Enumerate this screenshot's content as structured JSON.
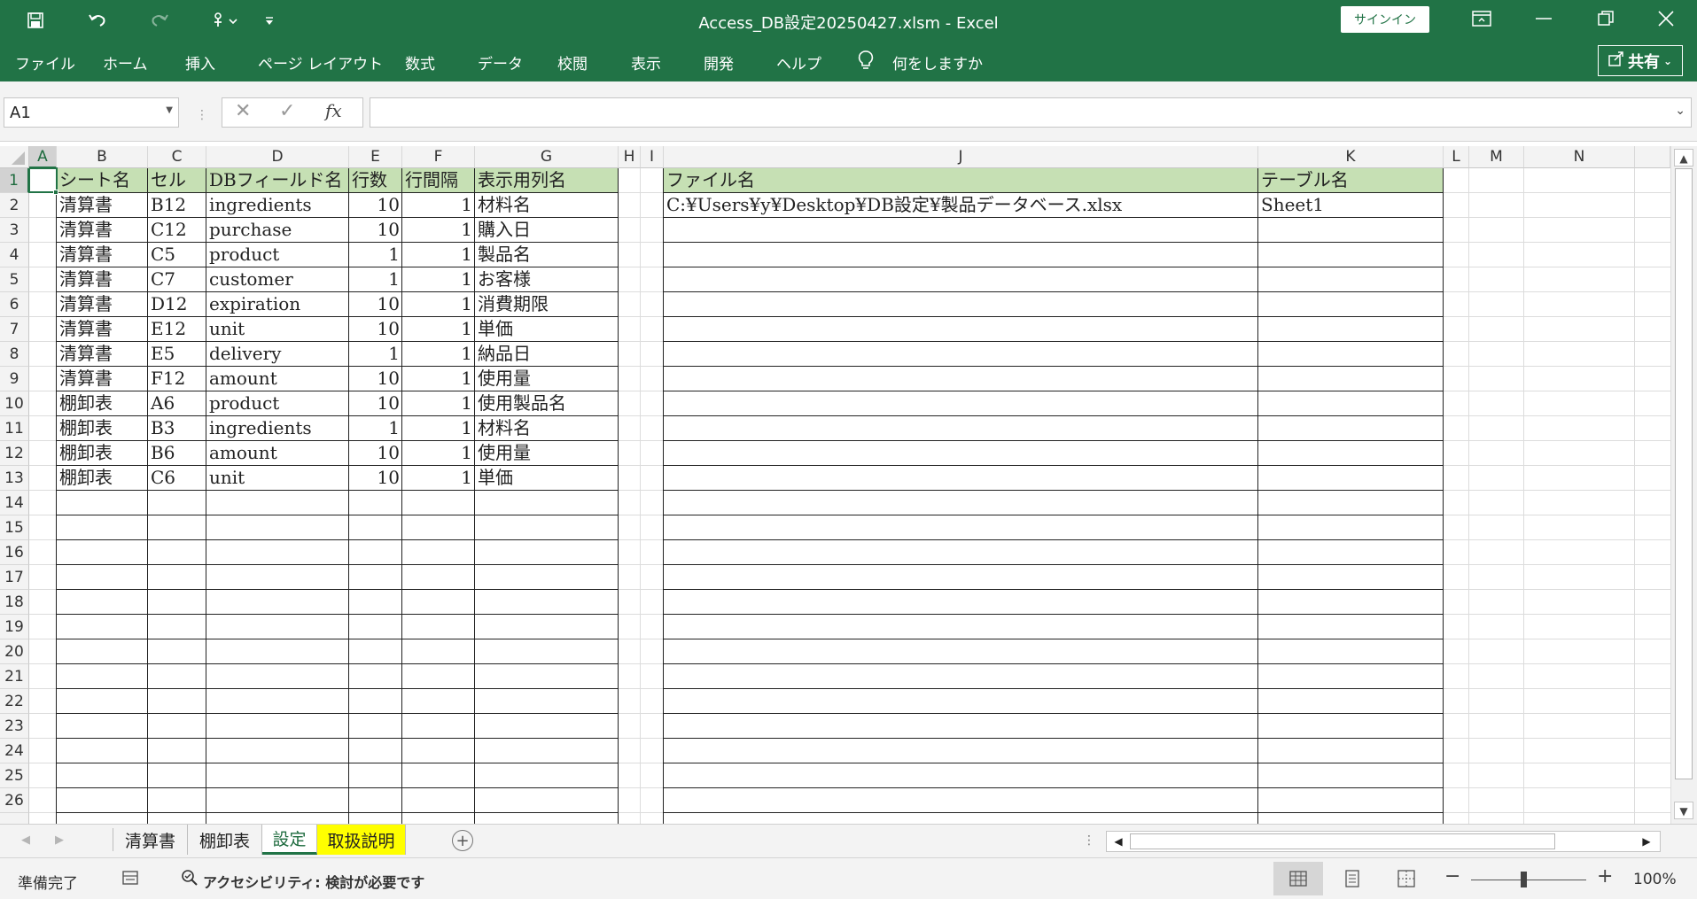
{
  "title_bar": {
    "title": "Access_DB設定20250427.xlsm  -  Excel",
    "signin_label": "サインイン"
  },
  "ribbon": {
    "tabs": [
      "ファイル",
      "ホーム",
      "挿入",
      "ページ レイアウト",
      "数式",
      "データ",
      "校閲",
      "表示",
      "開発",
      "ヘルプ"
    ],
    "tell_me": "何をしますか",
    "share_label": "共有"
  },
  "formula_bar": {
    "name_box": "A1",
    "fx_label": "fx",
    "formula": ""
  },
  "grid": {
    "columns": [
      "A",
      "B",
      "C",
      "D",
      "E",
      "F",
      "G",
      "H",
      "I",
      "J",
      "K",
      "L",
      "M",
      "N"
    ],
    "selected_cell": "A1",
    "header_row": {
      "B": "シート名",
      "C": "セル",
      "D": "DBフィールド名",
      "E": "行数",
      "F": "行間隔",
      "G": "表示用列名",
      "J": "ファイル名",
      "K": "テーブル名"
    },
    "file_info": {
      "file_path": "C:¥Users¥y¥Desktop¥DB設定¥製品データベース.xlsx",
      "table_name": "Sheet1"
    },
    "rows": [
      {
        "sheet": "清算書",
        "cell": "B12",
        "field": "ingredients",
        "rows": "10",
        "interval": "1",
        "display": "材料名"
      },
      {
        "sheet": "清算書",
        "cell": "C12",
        "field": "purchase",
        "rows": "10",
        "interval": "1",
        "display": "購入日"
      },
      {
        "sheet": "清算書",
        "cell": "C5",
        "field": "product",
        "rows": "1",
        "interval": "1",
        "display": "製品名"
      },
      {
        "sheet": "清算書",
        "cell": "C7",
        "field": "customer",
        "rows": "1",
        "interval": "1",
        "display": "お客様"
      },
      {
        "sheet": "清算書",
        "cell": "D12",
        "field": "expiration",
        "rows": "10",
        "interval": "1",
        "display": "消費期限"
      },
      {
        "sheet": "清算書",
        "cell": "E12",
        "field": "unit",
        "rows": "10",
        "interval": "1",
        "display": "単価"
      },
      {
        "sheet": "清算書",
        "cell": "E5",
        "field": "delivery",
        "rows": "1",
        "interval": "1",
        "display": "納品日"
      },
      {
        "sheet": "清算書",
        "cell": "F12",
        "field": "amount",
        "rows": "10",
        "interval": "1",
        "display": "使用量"
      },
      {
        "sheet": "棚卸表",
        "cell": "A6",
        "field": "product",
        "rows": "10",
        "interval": "1",
        "display": "使用製品名"
      },
      {
        "sheet": "棚卸表",
        "cell": "B3",
        "field": "ingredients",
        "rows": "1",
        "interval": "1",
        "display": "材料名"
      },
      {
        "sheet": "棚卸表",
        "cell": "B6",
        "field": "amount",
        "rows": "10",
        "interval": "1",
        "display": "使用量"
      },
      {
        "sheet": "棚卸表",
        "cell": "C6",
        "field": "unit",
        "rows": "10",
        "interval": "1",
        "display": "単価"
      }
    ],
    "row_numbers": [
      "1",
      "2",
      "3",
      "4",
      "5",
      "6",
      "7",
      "8",
      "9",
      "10",
      "11",
      "12",
      "13",
      "14",
      "15",
      "16",
      "17",
      "18",
      "19",
      "20",
      "21",
      "22",
      "23",
      "24",
      "25",
      "26"
    ]
  },
  "sheet_tabs": [
    {
      "label": "清算書",
      "state": "normal"
    },
    {
      "label": "棚卸表",
      "state": "normal"
    },
    {
      "label": "設定",
      "state": "active"
    },
    {
      "label": "取扱説明",
      "state": "yellow"
    }
  ],
  "status_bar": {
    "ready": "準備完了",
    "accessibility": "アクセシビリティ: 検討が必要です",
    "zoom": "100%"
  },
  "colors": {
    "excel_green": "#217346",
    "header_fill": "#c6e0b4",
    "tab_yellow": "#ffff00"
  }
}
